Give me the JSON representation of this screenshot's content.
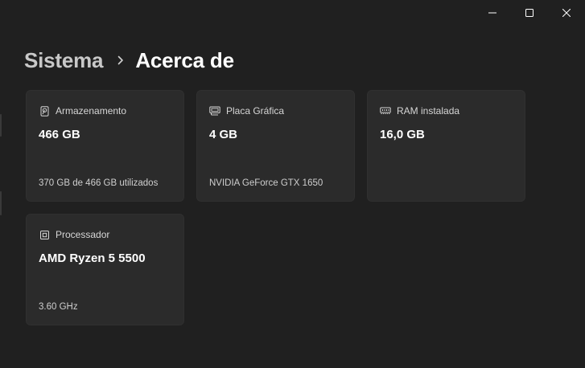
{
  "window": {
    "caption": {
      "minimize_icon": "minimize-icon",
      "maximize_icon": "maximize-icon",
      "close_icon": "close-icon"
    }
  },
  "breadcrumb": {
    "parent": "Sistema",
    "separator_icon": "chevron-right-icon",
    "current": "Acerca de"
  },
  "cards": [
    {
      "id": "storage",
      "icon": "storage-icon",
      "title": "Armazenamento",
      "value": "466 GB",
      "detail": "370 GB de 466 GB utilizados"
    },
    {
      "id": "graphics",
      "icon": "graphics-card-icon",
      "title": "Placa Gráfica",
      "value": "4 GB",
      "detail": "NVIDIA GeForce GTX 1650"
    },
    {
      "id": "ram",
      "icon": "ram-icon",
      "title": "RAM instalada",
      "value": "16,0 GB",
      "detail": ""
    },
    {
      "id": "processor",
      "icon": "processor-icon",
      "title": "Processador",
      "value": "AMD Ryzen 5 5500",
      "detail": "3.60 GHz"
    }
  ],
  "colors": {
    "background": "#202020",
    "card": "#2b2b2b",
    "text_primary": "#ffffff",
    "text_secondary": "#cfcfcf"
  }
}
